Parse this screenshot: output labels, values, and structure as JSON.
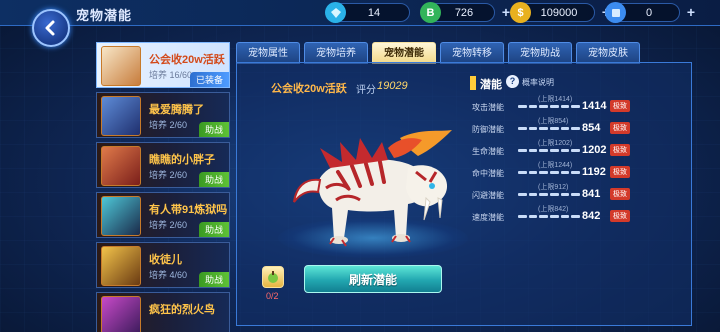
{
  "header": {
    "title": "宠物潜能",
    "resources": [
      {
        "icon": "diamond-icon",
        "value": "14",
        "color": "#2ab2e8"
      },
      {
        "icon": "b-coin-icon",
        "value": "726",
        "color": "#32b45a"
      },
      {
        "icon": "gold-coin-icon",
        "value": "109000",
        "color": "#e8b11f"
      },
      {
        "icon": "card-icon",
        "value": "0",
        "color": "#3c8cf0"
      }
    ]
  },
  "tabs": [
    "宠物属性",
    "宠物培养",
    "宠物潜能",
    "宠物转移",
    "宠物助战",
    "宠物皮肤"
  ],
  "active_tab": "宠物潜能",
  "pets": [
    {
      "name": "公会收20w活跃",
      "level": "培养 16/60",
      "tag": "已装备",
      "selected": true
    },
    {
      "name": "最爱腾腾了",
      "level": "培养 2/60",
      "tag": "助战"
    },
    {
      "name": "瞧瞧的小胖子",
      "level": "培养 2/60",
      "tag": "助战"
    },
    {
      "name": "有人带91炼狱吗",
      "level": "培养 2/60",
      "tag": "助战"
    },
    {
      "name": "收徒儿",
      "level": "培养 4/60",
      "tag": "助战"
    },
    {
      "name": "疯狂的烈火鸟",
      "level": "",
      "tag": ""
    }
  ],
  "detail": {
    "name": "公会收20w活跃",
    "score_label": "评分",
    "score": "19029",
    "item_count": "0/2",
    "refresh_label": "刷新潜能"
  },
  "potential": {
    "title": "潜能",
    "help_label": "概率说明",
    "stats": [
      {
        "name": "攻击潜能",
        "cap": "(上限1414)",
        "value": "1414",
        "grade": "极致",
        "segments": 6
      },
      {
        "name": "防御潜能",
        "cap": "(上限854)",
        "value": "854",
        "grade": "极致",
        "segments": 6
      },
      {
        "name": "生命潜能",
        "cap": "(上限1202)",
        "value": "1202",
        "grade": "极致",
        "segments": 6
      },
      {
        "name": "命中潜能",
        "cap": "(上限1244)",
        "value": "1192",
        "grade": "极致",
        "segments": 6
      },
      {
        "name": "闪避潜能",
        "cap": "(上限912)",
        "value": "841",
        "grade": "极致",
        "segments": 6
      },
      {
        "name": "速度潜能",
        "cap": "(上限842)",
        "value": "842",
        "grade": "极致",
        "segments": 6
      }
    ]
  }
}
